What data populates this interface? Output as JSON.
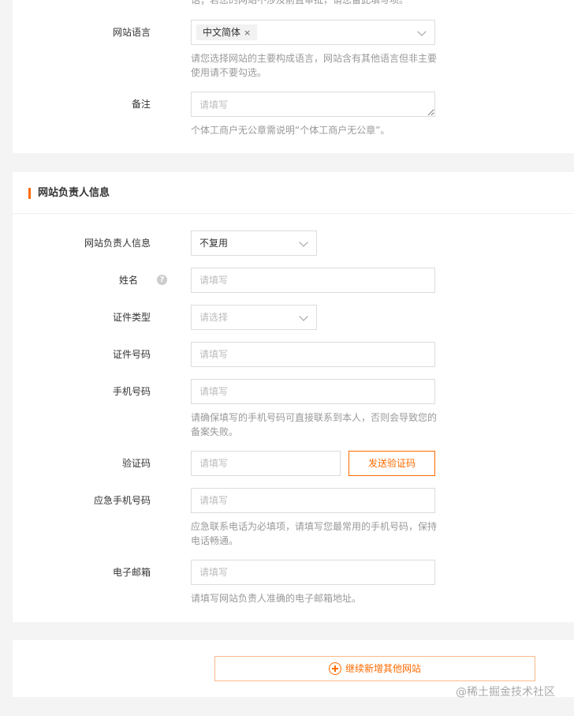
{
  "site_info": {
    "top_help_partial": "话；若您的网站不涉及前置审批，请您留此填写项。",
    "language": {
      "label": "网站语言",
      "selected_tag": "中文简体",
      "tag_remove": "×",
      "help": "请您选择网站的主要构成语言，网站含有其他语言但非主要使用请不要勾选。"
    },
    "remarks": {
      "label": "备注",
      "placeholder": "请填写",
      "help": "个体工商户无公章需说明“个体工商户无公章”。"
    }
  },
  "owner_section": {
    "title": "网站负责人信息",
    "reuse": {
      "label": "网站负责人信息",
      "value": "不复用"
    },
    "name": {
      "label": "姓名",
      "placeholder": "请填写",
      "help_icon": "?"
    },
    "id_type": {
      "label": "证件类型",
      "placeholder": "请选择"
    },
    "id_number": {
      "label": "证件号码",
      "placeholder": "请填写"
    },
    "mobile": {
      "label": "手机号码",
      "placeholder": "请填写",
      "help": "请确保填写的手机号码可直接联系到本人，否则会导致您的备案失败。"
    },
    "code": {
      "label": "验证码",
      "placeholder": "请填写",
      "send_button": "发送验证码"
    },
    "emergency": {
      "label": "应急手机号码",
      "placeholder": "请填写",
      "help": "应急联系电话为必填项，请填写您最常用的手机号码，保持电话畅通。"
    },
    "email": {
      "label": "电子邮箱",
      "placeholder": "请填写",
      "help": "请填写网站负责人准确的电子邮箱地址。"
    }
  },
  "footer": {
    "add_button": "继续新增其他网站",
    "watermark": "@稀土掘金技术社区"
  },
  "colors": {
    "accent": "#ff6a00",
    "border": "#dcdcdc",
    "help_text": "#999999"
  }
}
